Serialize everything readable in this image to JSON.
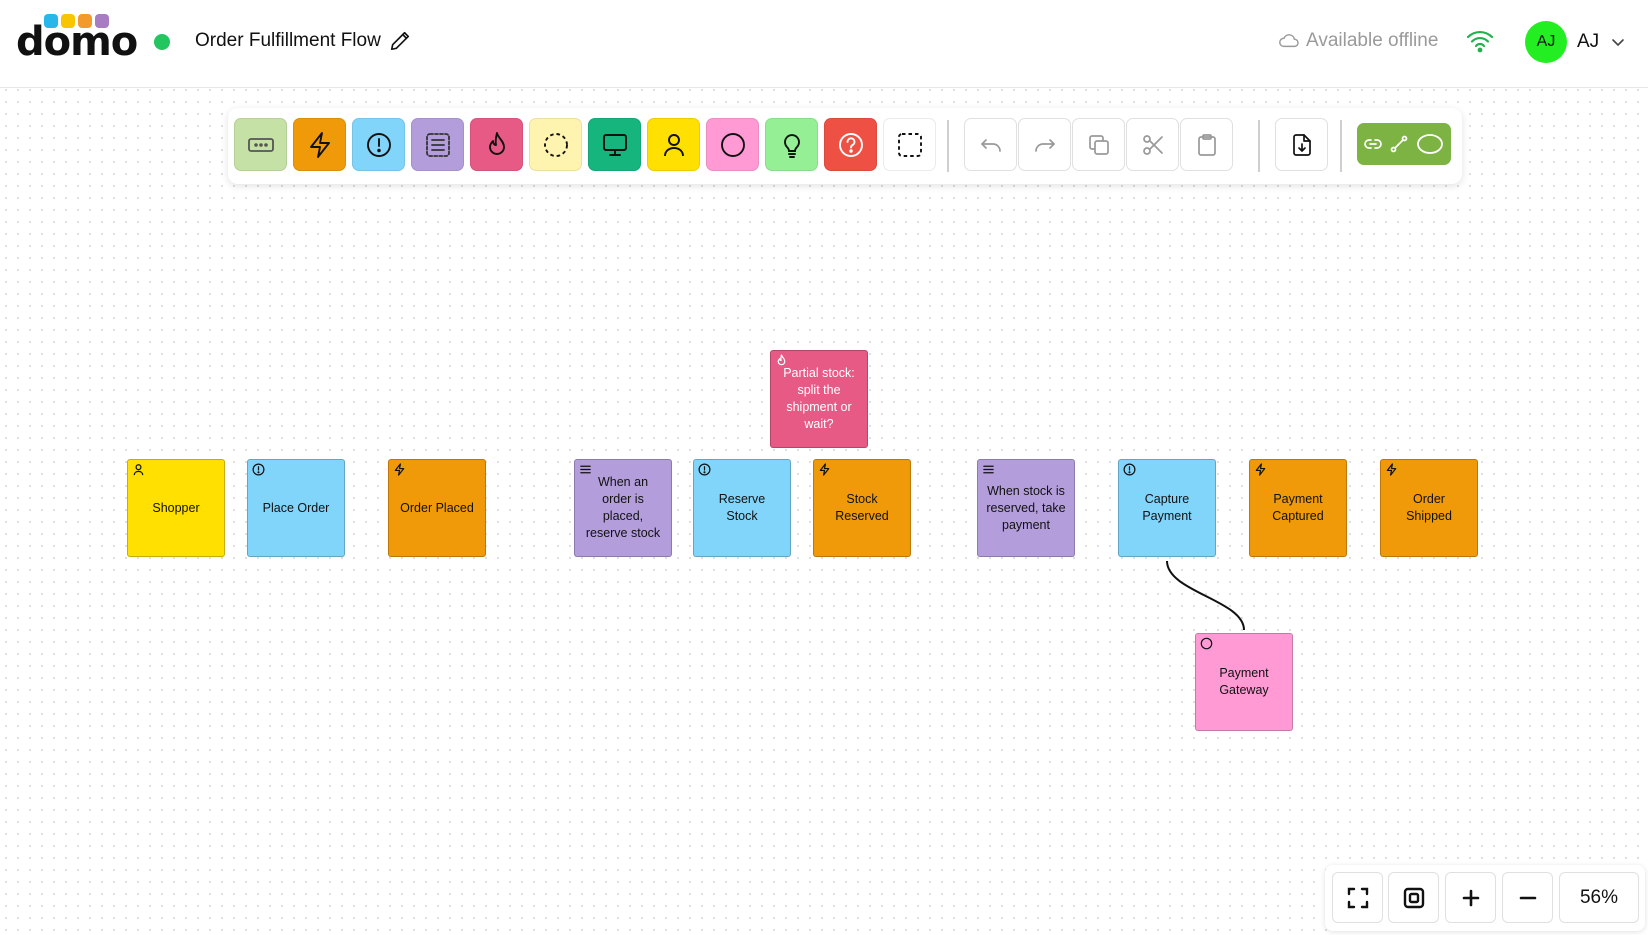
{
  "app": {
    "logo_text": "domo",
    "logo_colors": [
      "#29b6e8",
      "#f7c600",
      "#f39a2d",
      "#a77cc2"
    ]
  },
  "header": {
    "board_title": "Order Fulfillment Flow",
    "status_color": "#22c55e",
    "offline_label": "Available offline",
    "user": {
      "avatar_initials": "AJ",
      "name_initials": "AJ",
      "avatar_color": "#22ee22"
    }
  },
  "toolbar": {
    "palette": [
      {
        "name": "placeholder-tool",
        "icon": "dots-box-icon",
        "color": "#c5e1a5"
      },
      {
        "name": "event-tool",
        "icon": "lightning-icon",
        "color": "#f09a0a"
      },
      {
        "name": "command-tool",
        "icon": "alert-circle-icon",
        "color": "#81d4fa"
      },
      {
        "name": "policy-tool",
        "icon": "list-box-icon",
        "color": "#b39ddb"
      },
      {
        "name": "hotspot-tool",
        "icon": "flame-icon",
        "color": "#e85a86"
      },
      {
        "name": "boundary-tool",
        "icon": "dashed-circle-icon",
        "color": "#fff3b0"
      },
      {
        "name": "read-model-tool",
        "icon": "monitor-icon",
        "color": "#16b57e"
      },
      {
        "name": "actor-tool",
        "icon": "user-icon",
        "color": "#ffe000"
      },
      {
        "name": "external-system-tool",
        "icon": "circle-icon",
        "color": "#ff9ad5"
      },
      {
        "name": "opportunity-tool",
        "icon": "lightbulb-icon",
        "color": "#95ef95"
      },
      {
        "name": "question-tool",
        "icon": "question-circle-icon",
        "color": "#ee5144"
      },
      {
        "name": "frame-tool",
        "icon": "dashed-square-icon",
        "color": "#ffffff"
      }
    ],
    "actions": [
      {
        "name": "undo-button",
        "icon": "undo-icon"
      },
      {
        "name": "redo-button",
        "icon": "redo-icon"
      },
      {
        "name": "copy-button",
        "icon": "copy-icon"
      },
      {
        "name": "cut-button",
        "icon": "scissors-icon"
      },
      {
        "name": "paste-button",
        "icon": "clipboard-icon"
      }
    ],
    "export": {
      "name": "export-button",
      "icon": "file-download-icon"
    },
    "connector": {
      "icons": [
        "link-icon",
        "connector-icon",
        "ellipse-icon"
      ],
      "color": "#7cb342"
    }
  },
  "notes": [
    {
      "id": "shopper",
      "text": "Shopper",
      "icon": "user-icon",
      "color": "#ffe000"
    },
    {
      "id": "place-order",
      "text": "Place Order",
      "icon": "alert-circle-icon",
      "color": "#81d4fa"
    },
    {
      "id": "order-placed",
      "text": "Order Placed",
      "icon": "lightning-icon",
      "color": "#f09a0a"
    },
    {
      "id": "policy-reserve",
      "text": "When an order is placed, reserve stock",
      "icon": "list-icon",
      "color": "#b39ddb"
    },
    {
      "id": "reserve-stock",
      "text": "Reserve Stock",
      "icon": "alert-circle-icon",
      "color": "#81d4fa"
    },
    {
      "id": "stock-reserved",
      "text": "Stock Reserved",
      "icon": "lightning-icon",
      "color": "#f09a0a"
    },
    {
      "id": "policy-payment",
      "text": "When stock is reserved, take payment",
      "icon": "list-icon",
      "color": "#b39ddb"
    },
    {
      "id": "capture-payment",
      "text": "Capture Payment",
      "icon": "alert-circle-icon",
      "color": "#81d4fa"
    },
    {
      "id": "payment-captured",
      "text": "Payment Captured",
      "icon": "lightning-icon",
      "color": "#f09a0a"
    },
    {
      "id": "order-shipped",
      "text": "Order Shipped",
      "icon": "lightning-icon",
      "color": "#f09a0a"
    },
    {
      "id": "partial-stock",
      "text": "Partial stock: split the shipment or wait?",
      "icon": "flame-icon",
      "color": "#e85a86"
    },
    {
      "id": "payment-gateway",
      "text": "Payment Gateway",
      "icon": "circle-icon",
      "color": "#ff9ad5"
    }
  ],
  "zoom": {
    "buttons": [
      {
        "name": "fullscreen-button",
        "icon": "fullscreen-icon"
      },
      {
        "name": "fit-view-button",
        "icon": "fit-view-icon"
      },
      {
        "name": "zoom-in-button",
        "icon": "plus-icon"
      },
      {
        "name": "zoom-out-button",
        "icon": "minus-icon"
      }
    ],
    "level": "56%"
  }
}
